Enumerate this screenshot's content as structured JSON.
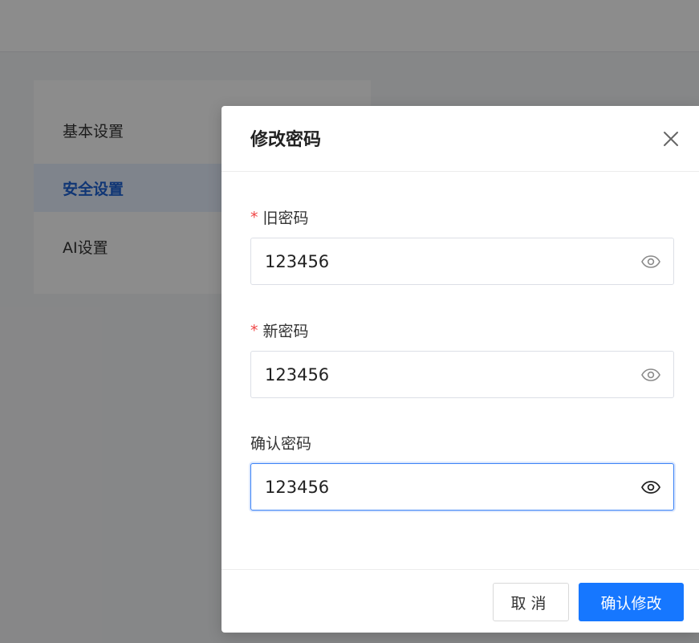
{
  "settings_menu": {
    "items": [
      {
        "label": "基本设置",
        "active": false
      },
      {
        "label": "安全设置",
        "active": true
      },
      {
        "label": "AI设置",
        "active": false
      }
    ]
  },
  "modal": {
    "title": "修改密码",
    "fields": [
      {
        "label": "旧密码",
        "required": true,
        "value": "123456"
      },
      {
        "label": "新密码",
        "required": true,
        "value": "123456"
      },
      {
        "label": "确认密码",
        "required": false,
        "value": "123456"
      }
    ],
    "required_mark": "*",
    "cancel_label": "取消",
    "confirm_label": "确认修改"
  },
  "icons": {
    "close": "close-icon",
    "visibility": "eye-icon"
  },
  "colors": {
    "primary": "#1677ff",
    "active_menu_text": "#1e63d6",
    "active_menu_bg": "#e8f1ff",
    "required": "#f04545",
    "focus_border": "#3b82f6"
  }
}
